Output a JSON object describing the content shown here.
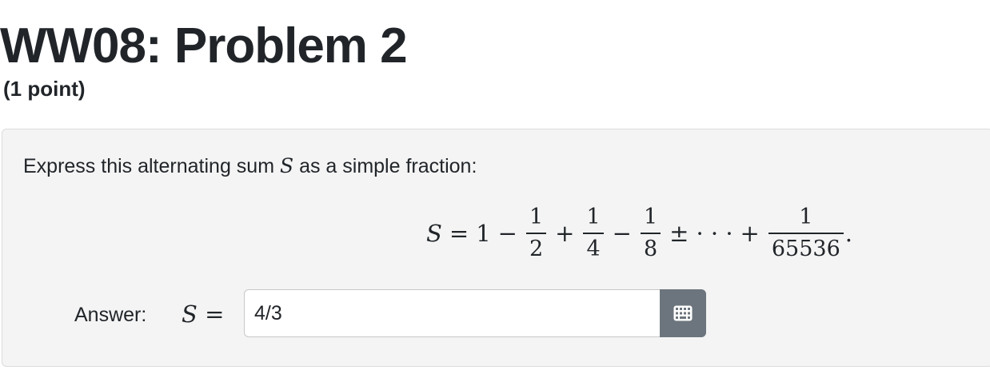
{
  "header": {
    "title": "WW08: Problem 2",
    "points": "(1 point)"
  },
  "problem": {
    "prompt_before": "Express this alternating sum ",
    "prompt_var": "S",
    "prompt_after": " as a simple fraction:",
    "equation": {
      "lhs": "S",
      "equals": "=",
      "terms": [
        {
          "kind": "text",
          "value": "1"
        },
        {
          "kind": "op",
          "value": "−"
        },
        {
          "kind": "frac",
          "num": "1",
          "den": "2"
        },
        {
          "kind": "op",
          "value": "+"
        },
        {
          "kind": "frac",
          "num": "1",
          "den": "4"
        },
        {
          "kind": "op",
          "value": "−"
        },
        {
          "kind": "frac",
          "num": "1",
          "den": "8"
        },
        {
          "kind": "op",
          "value": "±"
        },
        {
          "kind": "text",
          "value": "· · ·"
        },
        {
          "kind": "op",
          "value": "+"
        },
        {
          "kind": "frac",
          "num": "1",
          "den": "65536"
        },
        {
          "kind": "text",
          "value": "."
        }
      ]
    }
  },
  "answer": {
    "label": "Answer:",
    "var": "S =",
    "value": "4/3",
    "editor_icon": "calculator-grid-icon"
  },
  "colors": {
    "card_bg": "#f4f4f4",
    "button_bg": "#6c757d"
  }
}
